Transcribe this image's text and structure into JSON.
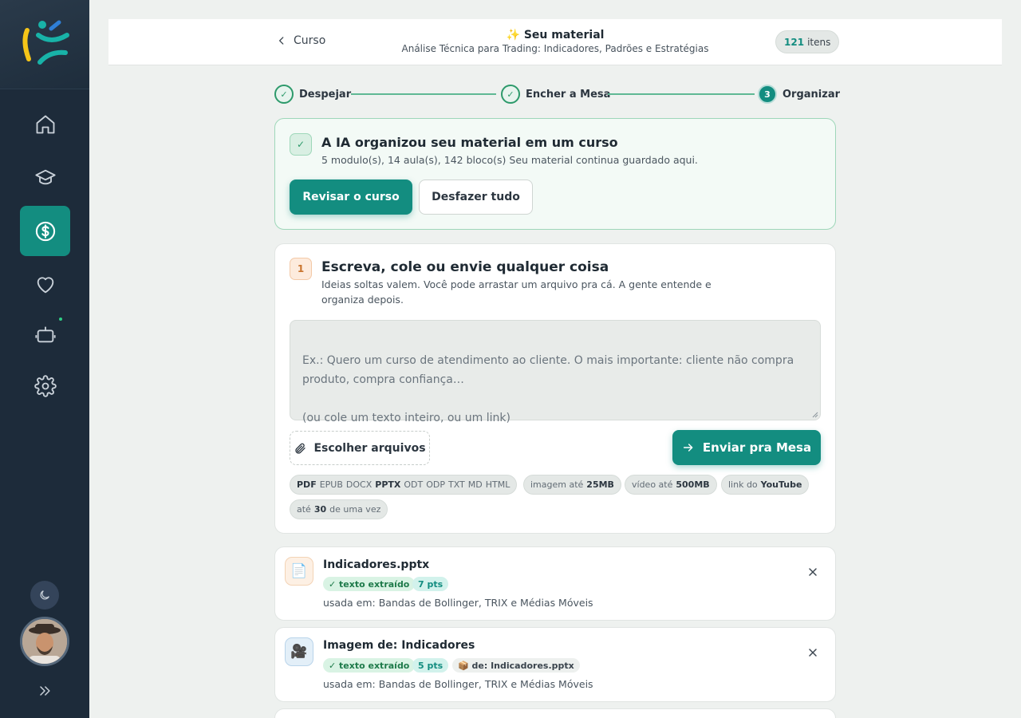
{
  "header": {
    "back_label": "Curso",
    "title": "✨ Seu material",
    "subtitle": "Análise Técnica para Trading: Indicadores, Padrões e Estratégias",
    "items_count": "121",
    "items_label": "itens"
  },
  "stepper": {
    "steps": [
      {
        "label": "Despejar",
        "marker": "✓"
      },
      {
        "label": "Encher a Mesa",
        "marker": "✓"
      },
      {
        "label": "Organizar",
        "marker": "3"
      }
    ]
  },
  "ai_card": {
    "icon": "✓",
    "title": "A IA organizou seu material em um curso",
    "summary": "5 modulo(s), 14 aula(s), 142 bloco(s) Seu material continua guardado aqui.",
    "review_label": "Revisar o curso",
    "undo_label": "Desfazer tudo"
  },
  "input_card": {
    "step_number": "1",
    "title": "Escreva, cole ou envie qualquer coisa",
    "description": "Ideias soltas valem. Você pode arrastar um arquivo pra cá. A gente entende e organiza depois.",
    "placeholder": "Ex.: Quero um curso de atendimento ao cliente. O mais importante: cliente não compra produto, compra confiança…\n\n(ou cole um texto inteiro, ou um link)",
    "choose_files_label": "Escolher arquivos",
    "send_label": "Enviar pra Mesa",
    "chips": [
      {
        "parts": [
          {
            "t": "PDF",
            "b": true
          },
          {
            "t": "EPUB",
            "b": false
          },
          {
            "t": "DOCX",
            "b": false
          },
          {
            "t": "PPTX",
            "b": true
          },
          {
            "t": "ODT",
            "b": false
          },
          {
            "t": "ODP",
            "b": false
          },
          {
            "t": "TXT",
            "b": false
          },
          {
            "t": "MD",
            "b": false
          },
          {
            "t": "HTML",
            "b": false
          }
        ]
      },
      {
        "parts": [
          {
            "t": "imagem até",
            "b": false
          },
          {
            "t": "25MB",
            "b": true
          }
        ]
      },
      {
        "parts": [
          {
            "t": "vídeo até",
            "b": false
          },
          {
            "t": "500MB",
            "b": true
          }
        ]
      },
      {
        "parts": [
          {
            "t": "link do",
            "b": false
          },
          {
            "t": "YouTube",
            "b": true
          }
        ]
      },
      {
        "parts": [
          {
            "t": "até",
            "b": false
          },
          {
            "t": "30",
            "b": true
          },
          {
            "t": "de uma vez",
            "b": false
          }
        ]
      }
    ]
  },
  "files": [
    {
      "icon": "📄",
      "icon_bg": "#fdf0e4",
      "icon_border": "#f3d3b5",
      "name": "Indicadores.pptx",
      "status": "✓ texto extraído",
      "points": "7 pts",
      "source": "",
      "used_in": "usada em: Bandas de Bollinger, TRIX e Médias Móveis"
    },
    {
      "icon": "🎥",
      "icon_bg": "#e3eff8",
      "icon_border": "#b9d4ea",
      "name": "Imagem de: Indicadores",
      "status": "✓ texto extraído",
      "points": "5 pts",
      "source": "📦 de: Indicadores.pptx",
      "used_in": "usada em: Bandas de Bollinger, TRIX e Médias Móveis"
    }
  ],
  "colors": {
    "sidebar": "#1d2b3a",
    "accent": "#138d80",
    "success": "#2d9a6b"
  }
}
